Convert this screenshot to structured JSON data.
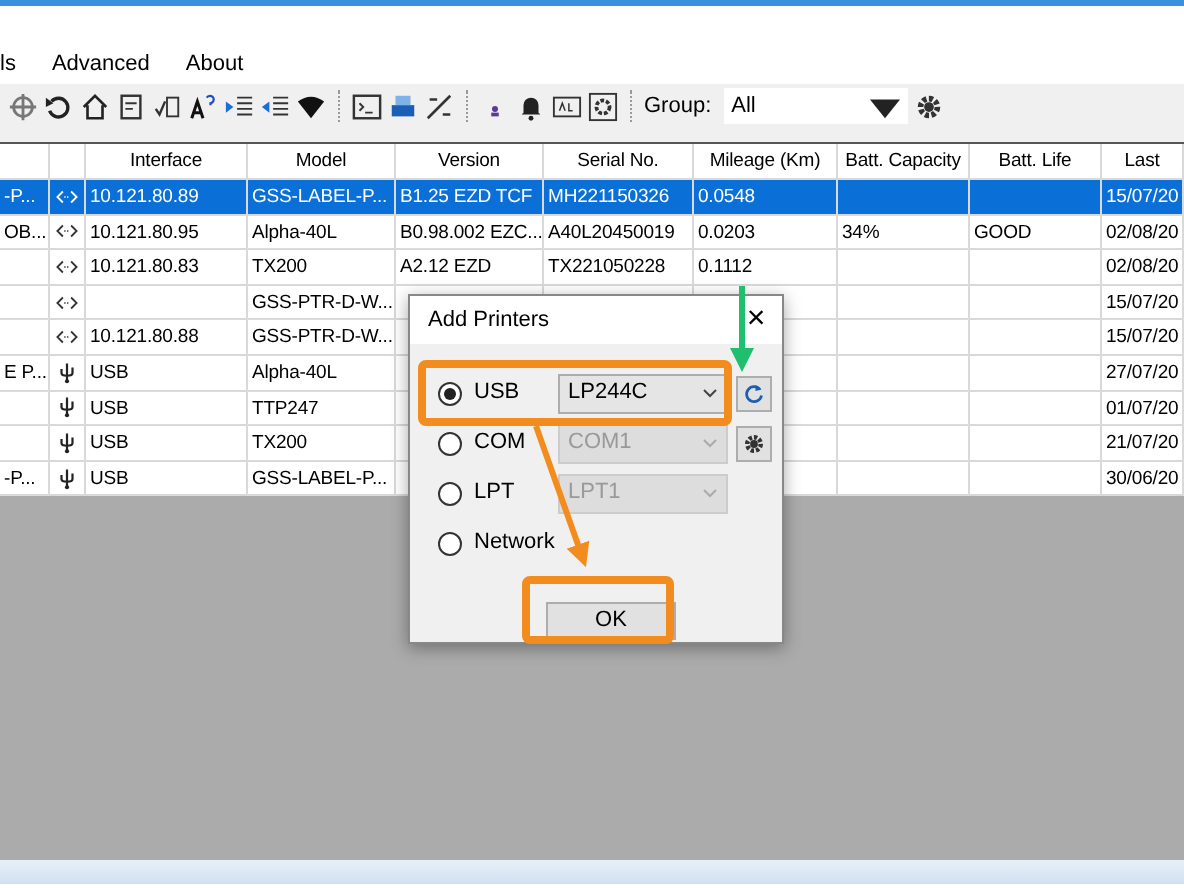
{
  "menu": [
    "ls",
    "Advanced",
    "About"
  ],
  "toolbar": {
    "group_label": "Group:",
    "group_value": "All"
  },
  "table": {
    "headings": {
      "interface": "Interface",
      "model": "Model",
      "version": "Version",
      "serial": "Serial No.",
      "mileage": "Mileage (Km)",
      "batt_capacity": "Batt. Capacity",
      "batt_life": "Batt. Life",
      "last": "Last"
    },
    "rows": [
      {
        "selected": true,
        "kind": "network",
        "name": "-P...",
        "interface": "10.121.80.89",
        "model": "GSS-LABEL-P...",
        "version": "B1.25 EZD TCF",
        "serial": "MH221150326",
        "mileage": "0.0548",
        "last": "15/07/20"
      },
      {
        "selected": false,
        "kind": "network",
        "name": "OB...",
        "interface": "10.121.80.95",
        "model": "Alpha-40L",
        "version": "B0.98.002 EZC...",
        "serial": "A40L20450019",
        "mileage": "0.0203",
        "batt_capacity": "34%",
        "batt_life": "GOOD",
        "last": "02/08/20"
      },
      {
        "selected": false,
        "kind": "network",
        "interface": "10.121.80.83",
        "model": "TX200",
        "version": "A2.12 EZD",
        "serial": "TX221050228",
        "mileage": "0.1112",
        "last": "02/08/20"
      },
      {
        "selected": false,
        "kind": "network",
        "model": "GSS-PTR-D-W...",
        "last": "15/07/20"
      },
      {
        "selected": false,
        "kind": "network",
        "interface": "10.121.80.88",
        "model": "GSS-PTR-D-W...",
        "last": "15/07/20"
      },
      {
        "selected": false,
        "kind": "usb",
        "name": "E P...",
        "interface": "USB",
        "model": "Alpha-40L",
        "last": "27/07/20"
      },
      {
        "selected": false,
        "kind": "usb",
        "interface": "USB",
        "model": "TTP247",
        "last": "01/07/20"
      },
      {
        "selected": false,
        "kind": "usb",
        "interface": "USB",
        "model": "TX200",
        "last": "21/07/20"
      },
      {
        "selected": false,
        "kind": "usb",
        "name": "-P...",
        "interface": "USB",
        "model": "GSS-LABEL-P...",
        "last": "30/06/20"
      }
    ]
  },
  "dialog": {
    "title": "Add Printers",
    "close": "×",
    "ok": "OK",
    "options": [
      {
        "kind": "usb",
        "label": "USB",
        "selected": true,
        "value": "LP244C",
        "disabled": false
      },
      {
        "kind": "com",
        "label": "COM",
        "selected": false,
        "value": "COM1",
        "disabled": true
      },
      {
        "kind": "lpt",
        "label": "LPT",
        "selected": false,
        "value": "LPT1",
        "disabled": true
      },
      {
        "kind": "network",
        "label": "Network",
        "selected": false
      }
    ]
  }
}
